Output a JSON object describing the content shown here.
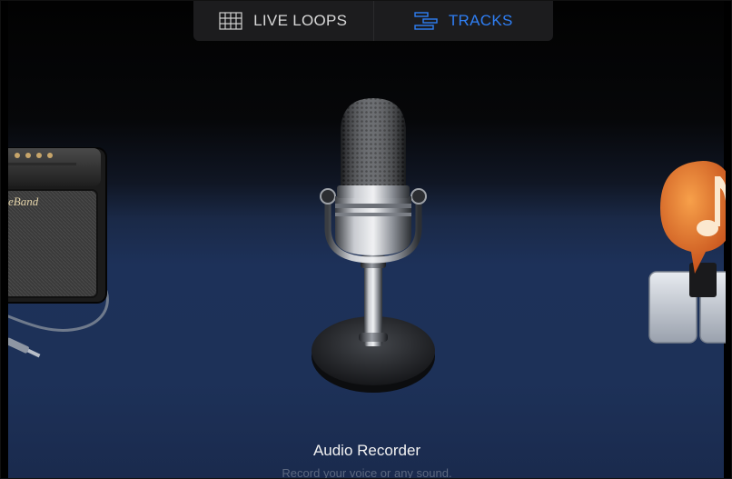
{
  "segmented_control": {
    "live_loops_label": "LIVE LOOPS",
    "tracks_label": "TRACKS",
    "selected": "TRACKS",
    "live_loops_icon": "grid-icon",
    "tracks_icon": "tracks-icon"
  },
  "instruments": {
    "left": {
      "icon": "guitar-amp-icon",
      "brand_text": "eBand"
    },
    "center": {
      "icon": "microphone-icon",
      "title": "Audio Recorder",
      "subtitle": "Record your voice or any sound."
    },
    "right": {
      "icon": "keyboard-music-icon"
    }
  },
  "colors": {
    "accent": "#2f7ff5",
    "background_top": "#030303",
    "background_bottom": "#1d3159"
  }
}
